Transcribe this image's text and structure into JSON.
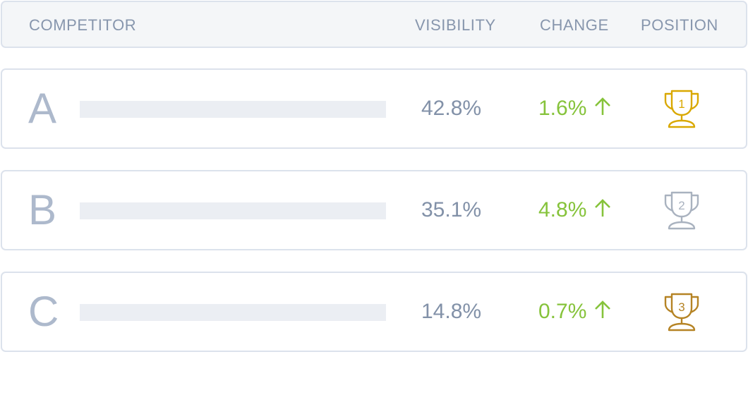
{
  "header": {
    "competitor": "COMPETITOR",
    "visibility": "VISIBILITY",
    "change": "CHANGE",
    "position": "POSITION"
  },
  "colors": {
    "gold": "#d9a800",
    "silver": "#a9b2bf",
    "bronze": "#b58324",
    "positive": "#86c33b"
  },
  "rows": [
    {
      "name": "A",
      "visibility": "42.8%",
      "change": "1.6%",
      "direction": "up",
      "position": "1",
      "trophy": "gold"
    },
    {
      "name": "B",
      "visibility": "35.1%",
      "change": "4.8%",
      "direction": "up",
      "position": "2",
      "trophy": "silver"
    },
    {
      "name": "C",
      "visibility": "14.8%",
      "change": "0.7%",
      "direction": "up",
      "position": "3",
      "trophy": "bronze"
    }
  ]
}
